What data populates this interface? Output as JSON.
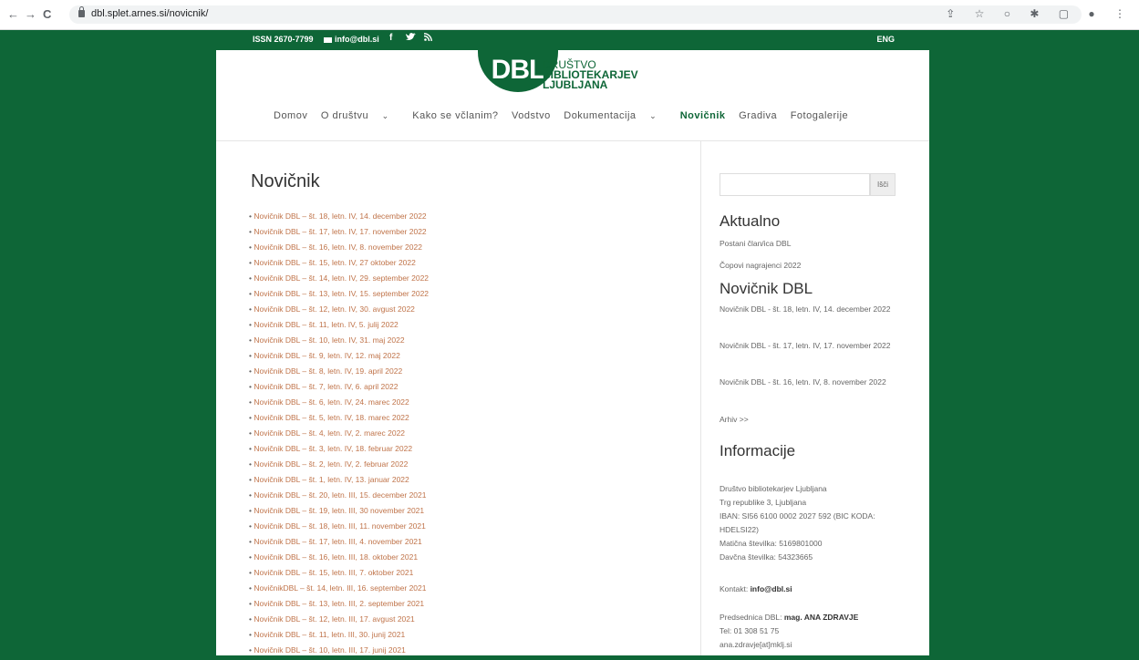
{
  "browser": {
    "back": "←",
    "forward": "→",
    "reload": "C",
    "url": "dbl.splet.arnes.si/novicnik/",
    "toolbar_icons": "⇪ ☆ ○ ✱ ▢ ● ⋮"
  },
  "topbar": {
    "issn": "ISSN 2670-7799",
    "email": "info@dbl.si",
    "facebook": "f",
    "twitter": "🐦",
    "rss": "⊃",
    "lang": "ENG"
  },
  "logo": {
    "mark": "DBL",
    "line1": "DRUŠTVO",
    "line2": "BIBLIOTEKARJEV",
    "line3": "LJUBLJANA"
  },
  "nav": {
    "items": [
      {
        "label": "Domov"
      },
      {
        "label": "O društvu",
        "dropdown": true
      },
      {
        "label": "Kako se včlanim?"
      },
      {
        "label": "Vodstvo"
      },
      {
        "label": "Dokumentacija",
        "dropdown": true
      },
      {
        "label": "Novičnik",
        "active": true
      },
      {
        "label": "Gradiva"
      },
      {
        "label": "Fotogalerije"
      }
    ],
    "chevron": "⌄"
  },
  "main": {
    "title": "Novičnik",
    "newsletters": [
      "Novičnik DBL – št. 18, letn. IV, 14. december 2022",
      "Novičnik DBL – št. 17, letn. IV, 17. november 2022",
      "Novičnik DBL – št. 16, letn. IV, 8. november 2022",
      "Novičnik DBL – št. 15, letn. IV, 27 oktober 2022",
      "Novičnik DBL – št. 14, letn. IV, 29. september 2022",
      "Novičnik DBL – št. 13, letn. IV, 15. september 2022",
      "Novičnik DBL – št. 12, letn. IV, 30. avgust 2022",
      "Novičnik DBL – št. 11, letn. IV, 5. julij 2022",
      "Novičnik DBL – št. 10, letn. IV, 31. maj 2022",
      "Novičnik DBL – št. 9, letn. IV, 12. maj 2022",
      "Novičnik DBL – št. 8, letn. IV, 19. april 2022",
      "Novičnik DBL – št. 7, letn. IV, 6. april 2022",
      "Novičnik DBL – št. 6, letn. IV, 24. marec 2022",
      "Novičnik DBL – št. 5, letn. IV, 18. marec 2022",
      "Novičnik DBL – št. 4, letn. IV, 2. marec 2022",
      "Novičnik DBL – št. 3, letn. IV, 18. februar 2022",
      "Novičnik DBL – št. 2, letn. IV, 2. februar 2022",
      "Novičnik DBL – št. 1, letn. IV, 13. januar 2022",
      "Novičnik DBL – št. 20, letn. III, 15. december 2021",
      "Novičnik DBL – št. 19, letn. III, 30 november 2021",
      "Novičnik DBL – št. 18, letn. III, 11. november 2021",
      "Novičnik DBL – št. 17, letn. III, 4. november 2021",
      "Novičnik DBL – št. 16, letn. III, 18. oktober 2021",
      "Novičnik DBL – št. 15, letn. III, 7. oktober 2021",
      "NovičnikDBL – št. 14, letn. III, 16. september 2021",
      "Novičnik DBL – št. 13, letn. III, 2. september 2021",
      "Novičnik DBL – št. 12, letn. III, 17. avgust 2021",
      "Novičnik DBL – št. 11, letn. III, 30. junij 2021",
      "Novičnik DBL – št. 10, letn. III, 17. junij 2021"
    ]
  },
  "sidebar": {
    "search_button": "Išči",
    "search_value": "",
    "aktualno_title": "Aktualno",
    "aktualno_links": [
      "Postani član/ica DBL",
      "Čopovi nagrajenci 2022"
    ],
    "novicnik_title": "Novičnik DBL",
    "novicnik_links": [
      "Novičnik DBL - št. 18, letn. IV, 14. december 2022",
      "Novičnik DBL - št. 17, letn. IV, 17. november 2022",
      "Novičnik DBL - št. 16, letn. IV, 8. november 2022"
    ],
    "archive_link": "Arhiv >>",
    "info_title": "Informacije",
    "info_lines": [
      "Društvo bibliotekarjev Ljubljana",
      "Trg republike 3, Ljubljana",
      "IBAN: SI56 6100 0002 2027 592 (BIC KODA: HDELSI22)",
      "Matična številka: 5169801000",
      "Davčna številka: 54323665"
    ],
    "contact_label": "Kontakt: ",
    "contact_email": "info@dbl.si",
    "president_label": "Predsednica DBL: ",
    "president_name": "mag. ANA ZDRAVJE",
    "phone": "Tel: 01 308 51 75",
    "president_email": "ana.zdravje[at]mklj.si"
  },
  "colors": {
    "brand_green": "#0e6637",
    "link_orange": "#c0744a"
  }
}
